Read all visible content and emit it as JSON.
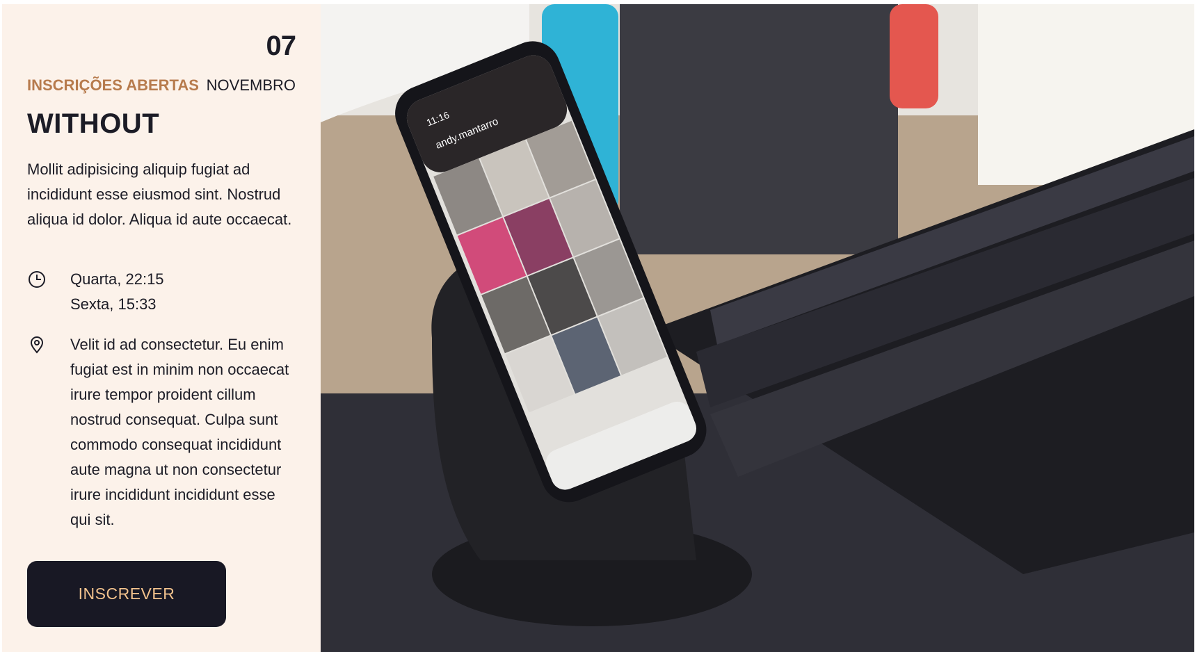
{
  "event": {
    "day": "07",
    "month": "NOVEMBRO",
    "status": "INSCRIÇÕES ABERTAS",
    "title": "WITHOUT",
    "description": "Mollit adipisicing aliquip fugiat ad incididunt esse eiusmod sint. Nostrud aliqua id dolor. Aliqua id aute occaecat.",
    "schedule": [
      "Quarta, 22:15",
      "Sexta, 15:33"
    ],
    "location": "Velit id ad consectetur. Eu enim fugiat est in minim non occaecat irure tempor proident cillum nostrud consequat. Culpa sunt commodo consequat incididunt aute magna ut non consectetur irure incididunt incididunt esse qui sit.",
    "button_label": "INSCREVER"
  },
  "hero": {
    "phone_username": "andy.mantarro",
    "phone_time": "11:16"
  },
  "colors": {
    "panel_bg": "#fcf2ea",
    "accent": "#b77b4d",
    "button_bg": "#181824",
    "button_text": "#f2c28d"
  },
  "icons": {
    "time": "clock-icon",
    "location": "map-pin-icon"
  }
}
